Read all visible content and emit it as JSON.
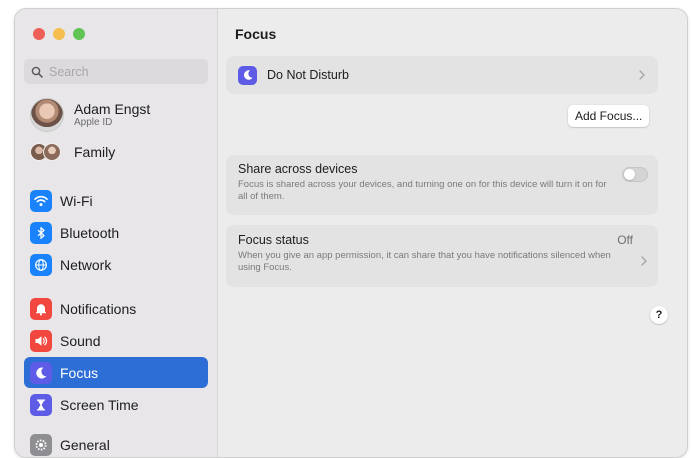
{
  "search": {
    "placeholder": "Search"
  },
  "account": {
    "name": "Adam Engst",
    "subtitle": "Apple ID"
  },
  "family": {
    "label": "Family"
  },
  "sidebar": {
    "items": [
      {
        "label": "Wi-Fi",
        "icon": "wifi-icon",
        "color": "#1a82fb"
      },
      {
        "label": "Bluetooth",
        "icon": "bluetooth-icon",
        "color": "#1a82fb"
      },
      {
        "label": "Network",
        "icon": "globe-icon",
        "color": "#1a82fb"
      },
      {
        "label": "Notifications",
        "icon": "bell-icon",
        "color": "#f2473f"
      },
      {
        "label": "Sound",
        "icon": "speaker-icon",
        "color": "#f2473f"
      },
      {
        "label": "Focus",
        "icon": "moon-icon",
        "color": "#5e5ce6",
        "selected": true
      },
      {
        "label": "Screen Time",
        "icon": "hourglass-icon",
        "color": "#5e5ce6"
      },
      {
        "label": "General",
        "icon": "gear-icon",
        "color": "#8e8e93"
      }
    ]
  },
  "main": {
    "title": "Focus",
    "do_not_disturb": {
      "label": "Do Not Disturb"
    },
    "add_focus_label": "Add Focus...",
    "share": {
      "title": "Share across devices",
      "description": "Focus is shared across your devices, and turning one on for this device will turn it on for all of them.",
      "enabled": false
    },
    "focus_status": {
      "title": "Focus status",
      "value": "Off",
      "description": "When you give an app permission, it can share that you have notifications silenced when using Focus."
    },
    "help_label": "?"
  },
  "colors": {
    "accent": "#2c6ed6",
    "focus_purple": "#5e5ce6"
  }
}
